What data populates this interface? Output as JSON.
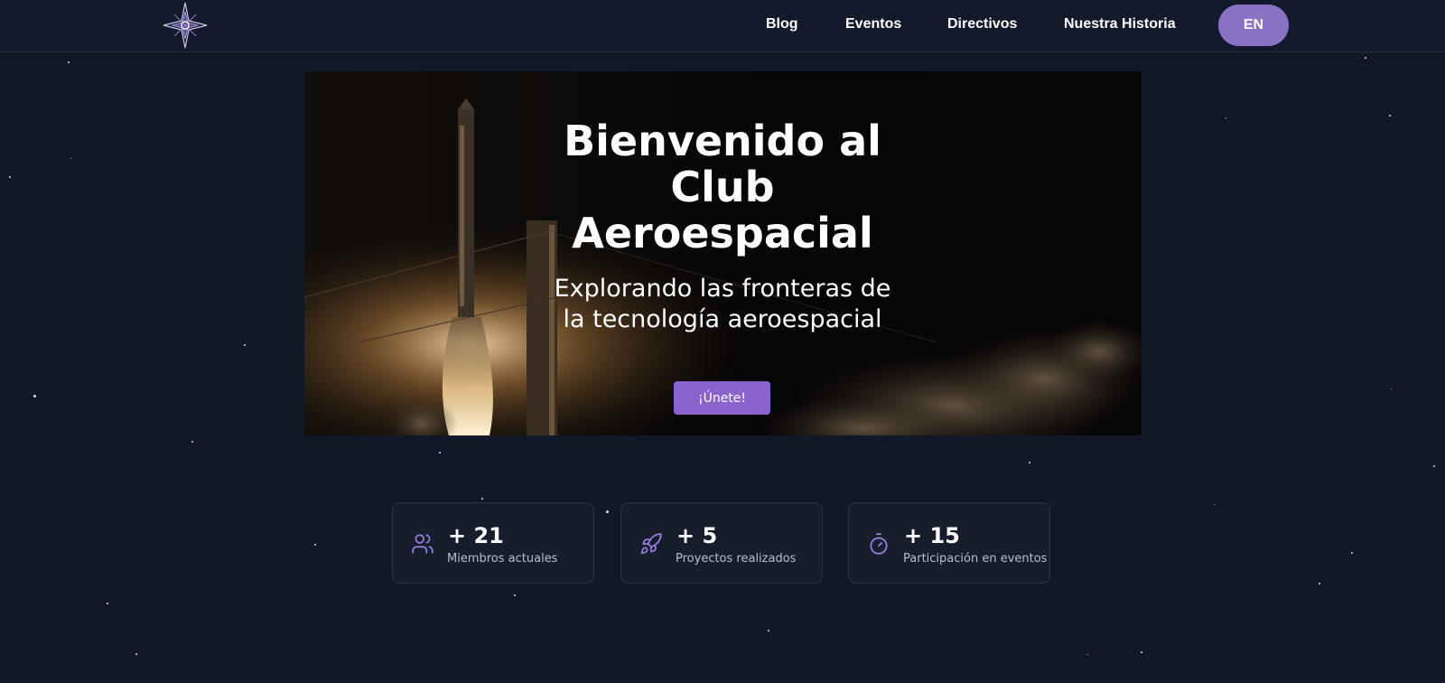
{
  "header": {
    "logo_icon": "four-point-star-logo",
    "nav": [
      {
        "label": "Blog"
      },
      {
        "label": "Eventos"
      },
      {
        "label": "Directivos"
      },
      {
        "label": "Nuestra Historia"
      }
    ],
    "language_button": "EN"
  },
  "hero": {
    "title": "Bienvenido al Club Aeroespacial",
    "subtitle": "Explorando las fronteras de la tecnología aeroespacial",
    "cta_label": "¡Únete!",
    "background_image": "rocket-launch-night"
  },
  "stats": [
    {
      "icon": "users-icon",
      "value": "+ 21",
      "label": "Miembros actuales"
    },
    {
      "icon": "rocket-icon",
      "value": "+ 5",
      "label": "Proyectos realizados"
    },
    {
      "icon": "stopwatch-icon",
      "value": "+ 15",
      "label": "Participación en eventos"
    }
  ],
  "colors": {
    "background": "#111827",
    "accent": "#8a63cf",
    "language_button": "#8c72c6",
    "card_background": "#161e2e",
    "icon_purple": "#9b7ee0"
  }
}
